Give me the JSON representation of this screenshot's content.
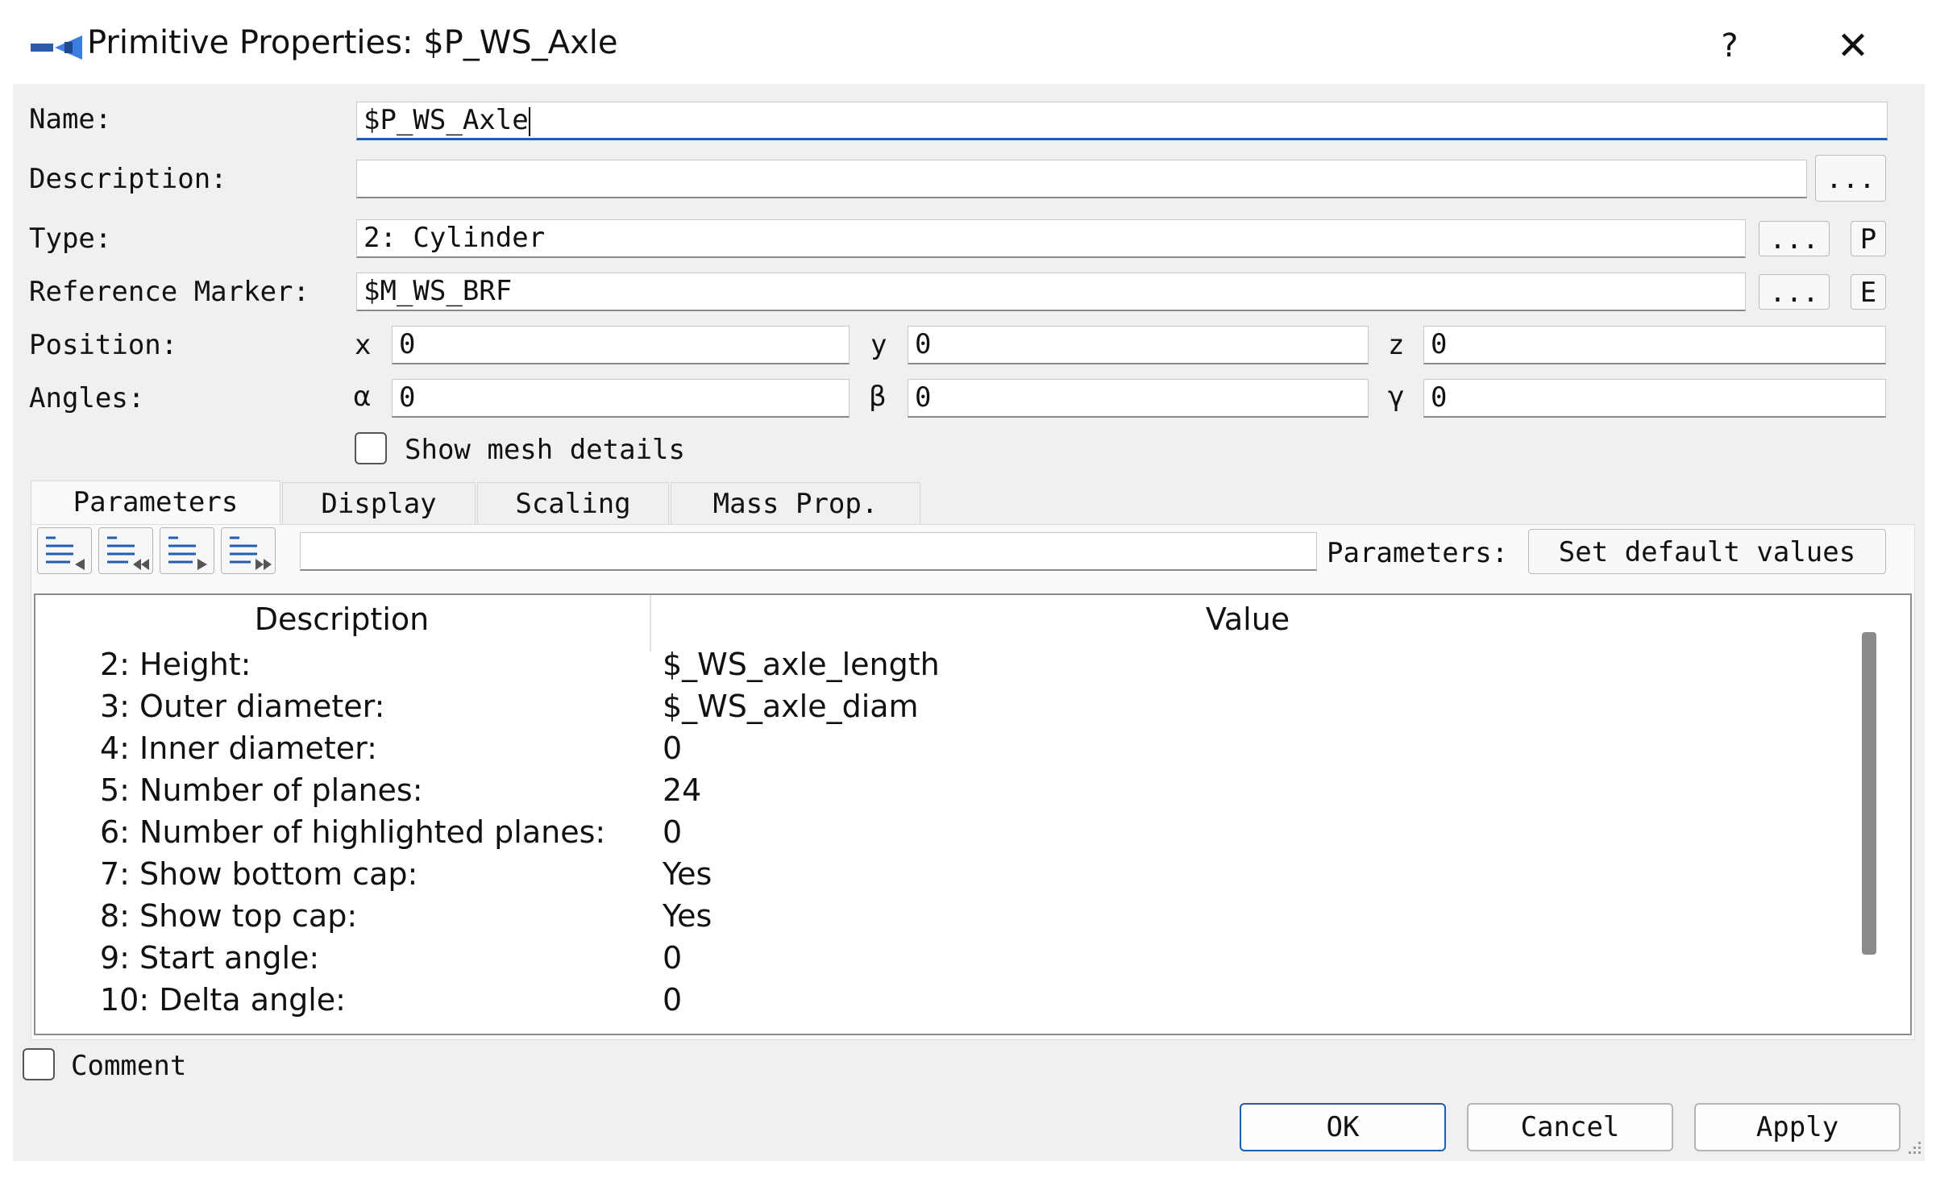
{
  "window": {
    "title": "Primitive Properties: $P_WS_Axle",
    "help_label": "?",
    "close_label": "✕"
  },
  "form": {
    "name": {
      "label": "Name:",
      "value": "$P_WS_Axle"
    },
    "description": {
      "label": "Description:",
      "value": "",
      "button": "..."
    },
    "type": {
      "label": "Type:",
      "value": "2: Cylinder",
      "button": "...",
      "extra_button": "P"
    },
    "reference_marker": {
      "label": "Reference Marker:",
      "value": "$M_WS_BRF",
      "button": "...",
      "extra_button": "E"
    },
    "position": {
      "label": "Position:",
      "x_label": "x",
      "x": "0",
      "y_label": "y",
      "y": "0",
      "z_label": "z",
      "z": "0"
    },
    "angles": {
      "label": "Angles:",
      "a_label": "α",
      "a": "0",
      "b_label": "β",
      "b": "0",
      "g_label": "γ",
      "g": "0"
    },
    "show_mesh_details": {
      "label": "Show mesh details",
      "checked": false
    }
  },
  "tabs": [
    {
      "label": "Parameters",
      "active": true
    },
    {
      "label": "Display",
      "active": false
    },
    {
      "label": "Scaling",
      "active": false
    },
    {
      "label": "Mass Prop.",
      "active": false
    }
  ],
  "toolbar": {
    "icons": [
      "list-prev-icon",
      "list-first-icon",
      "list-next-icon",
      "list-last-icon"
    ],
    "filter_value": "",
    "parameters_label": "Parameters:",
    "defaults_button": "Set default values"
  },
  "table": {
    "columns": [
      "Description",
      "Value"
    ],
    "rows": [
      {
        "description": "2: Height:",
        "value": "$_WS_axle_length"
      },
      {
        "description": "3: Outer diameter:",
        "value": "$_WS_axle_diam"
      },
      {
        "description": "4: Inner diameter:",
        "value": "0"
      },
      {
        "description": "5: Number of planes:",
        "value": "24"
      },
      {
        "description": "6: Number of highlighted planes:",
        "value": "0"
      },
      {
        "description": "7: Show bottom cap:",
        "value": "Yes"
      },
      {
        "description": "8: Show top cap:",
        "value": "Yes"
      },
      {
        "description": "9: Start angle:",
        "value": "0"
      },
      {
        "description": "10: Delta angle:",
        "value": "0"
      }
    ]
  },
  "comment": {
    "label": "Comment",
    "checked": false
  },
  "buttons": {
    "ok": "OK",
    "cancel": "Cancel",
    "apply": "Apply"
  },
  "colors": {
    "accent": "#1f5fb0",
    "dialog_bg": "#f0f0f0"
  }
}
